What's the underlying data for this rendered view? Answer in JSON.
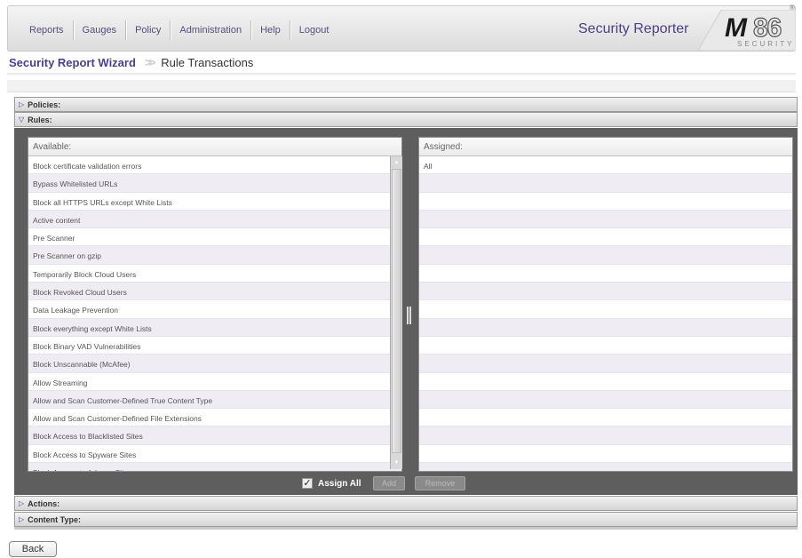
{
  "nav": {
    "items": [
      "Reports",
      "Gauges",
      "Policy",
      "Administration",
      "Help",
      "Logout"
    ],
    "app_title": "Security Reporter"
  },
  "brand": {
    "logo_main": "M",
    "logo_num": "86",
    "logo_sub": "SECURITY",
    "reg": "®"
  },
  "breadcrumb": {
    "wizard": "Security Report Wizard",
    "step": "Rule Transactions"
  },
  "sections": {
    "policies": "Policies:",
    "rules": "Rules:",
    "actions": "Actions:",
    "content_type": "Content Type:"
  },
  "available": {
    "header": "Available:",
    "items": [
      "Block certificate validation errors",
      "Bypass Whitelisted URLs",
      "Block all HTTPS URLs except White Lists",
      "Active content",
      "Pre Scanner",
      "Pre Scanner on gzip",
      "Temporarily Block Cloud Users",
      "Block Revoked Cloud Users",
      "Data Leakage Prevention",
      "Block everything except White Lists",
      "Block Binary VAD Vulnerabilities",
      "Block Unscannable (McAfee)",
      "Allow Streaming",
      "Allow and Scan Customer-Defined True Content Type",
      "Allow and Scan Customer-Defined File Extensions",
      "Block Access to Blacklisted Sites",
      "Block Access to Spyware Sites",
      "Block Access to Adware Sites"
    ]
  },
  "assigned": {
    "header": "Assigned:",
    "items": [
      "All",
      "",
      "",
      "",
      "",
      "",
      "",
      "",
      "",
      "",
      "",
      "",
      "",
      "",
      "",
      "",
      "",
      ""
    ]
  },
  "controls": {
    "assign_all": "Assign All",
    "assign_all_checked": true,
    "add": "Add",
    "remove": "Remove"
  },
  "footer": {
    "back": "Back"
  },
  "colors": {
    "accent": "#4c3f8a",
    "panel_bg": "#5e5e5e"
  }
}
